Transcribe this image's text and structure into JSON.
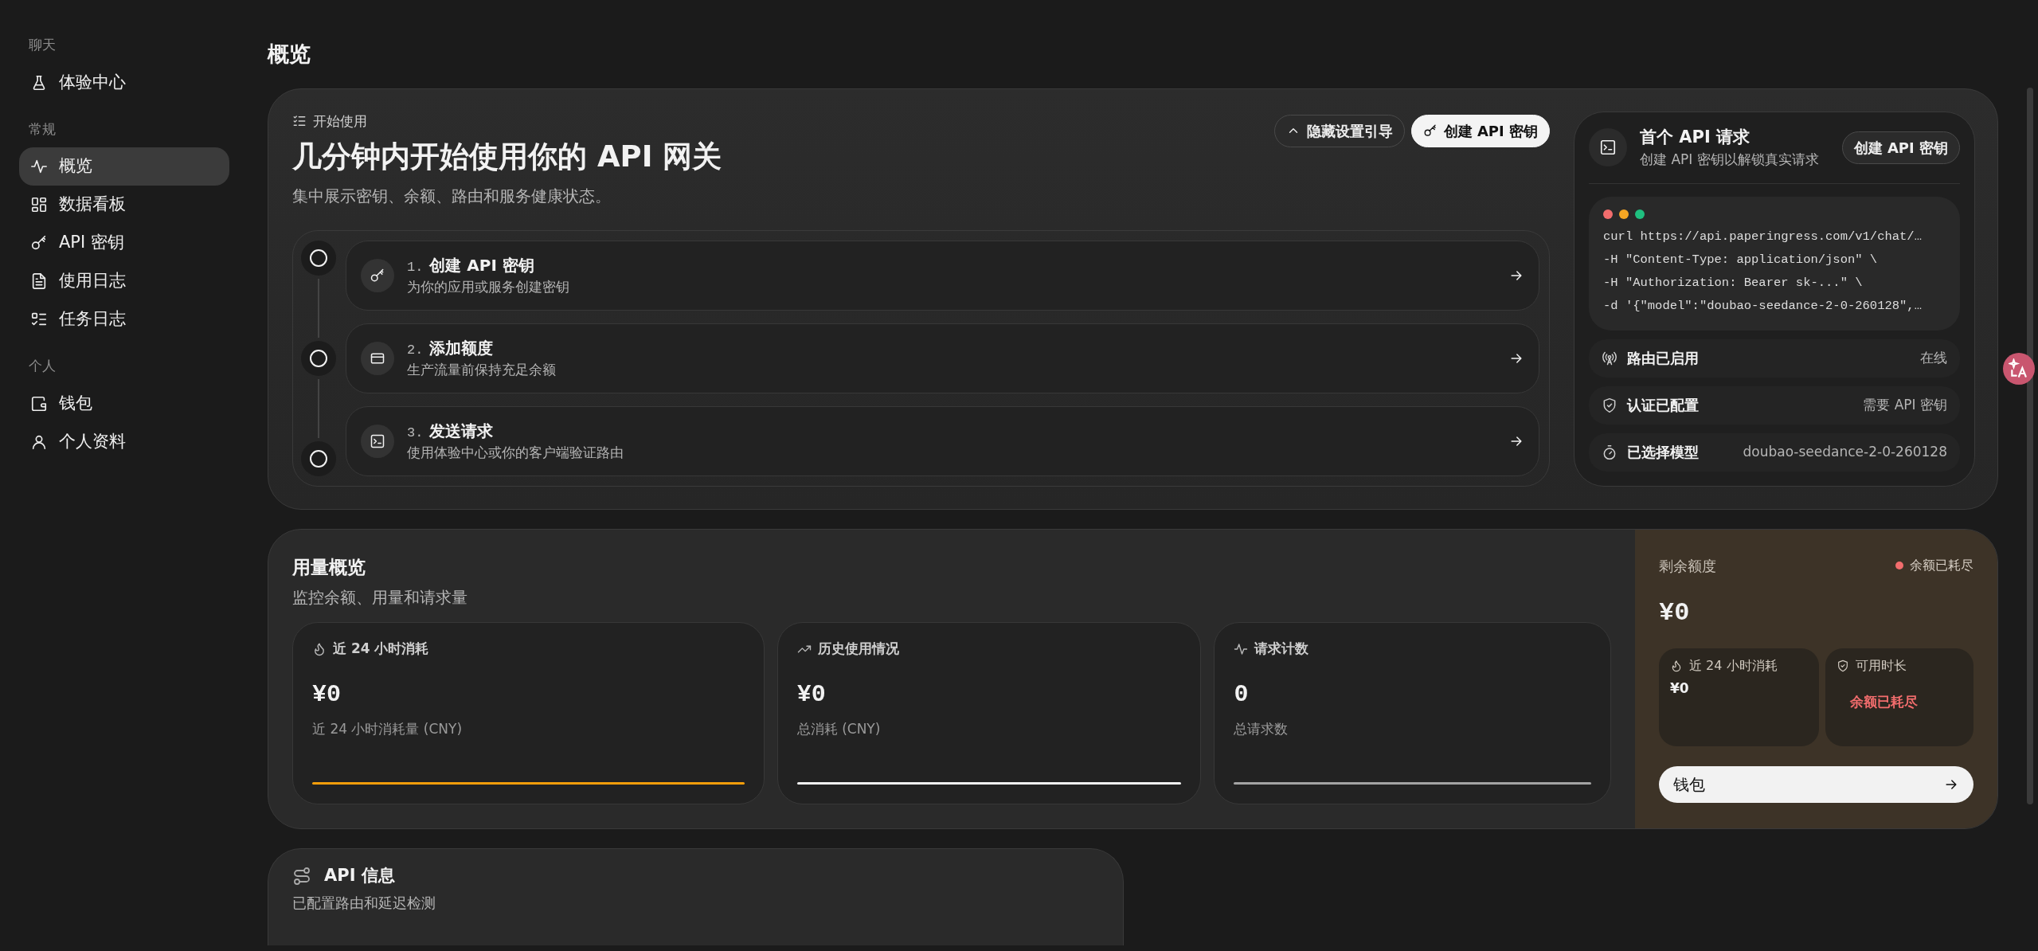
{
  "sidebar": {
    "sections": [
      {
        "label": "聊天",
        "items": [
          {
            "label": "体验中心",
            "selected": false
          }
        ]
      },
      {
        "label": "常规",
        "items": [
          {
            "label": "概览",
            "selected": true
          },
          {
            "label": "数据看板",
            "selected": false
          },
          {
            "label": "API 密钥",
            "selected": false
          },
          {
            "label": "使用日志",
            "selected": false
          },
          {
            "label": "任务日志",
            "selected": false
          }
        ]
      },
      {
        "label": "个人",
        "items": [
          {
            "label": "钱包",
            "selected": false
          },
          {
            "label": "个人资料",
            "selected": false
          }
        ]
      }
    ]
  },
  "page_title": "概览",
  "getting_started": {
    "label": "开始使用",
    "heading": "几分钟内开始使用你的 API 网关",
    "subtitle": "集中展示密钥、余额、路由和服务健康状态。",
    "buttons": [
      {
        "label": "隐藏设置引导",
        "kind": "outline"
      },
      {
        "label": "创建 API 密钥",
        "kind": "solid"
      }
    ],
    "steps": [
      {
        "number": "1.",
        "title": "创建 API 密钥",
        "description": "为你的应用或服务创建密钥",
        "completed": false
      },
      {
        "number": "2.",
        "title": "添加额度",
        "description": "生产流量前保持充足余额",
        "completed": false
      },
      {
        "number": "3.",
        "title": "发送请求",
        "description": "使用体验中心或你的客户端验证路由",
        "completed": false
      }
    ]
  },
  "first_request": {
    "title": "首个 API 请求",
    "subtitle": "创建 API 密钥以解锁真实请求",
    "button": "创建 API 密钥",
    "code_lines": [
      "curl https://api.paperingress.com/v1/chat/…",
      "-H \"Content-Type: application/json\" \\",
      "-H \"Authorization: Bearer sk-...\" \\",
      "-d '{\"model\":\"doubao-seedance-2-0-260128\",…"
    ],
    "status_rows": [
      {
        "label": "路由已启用",
        "value": "在线"
      },
      {
        "label": "认证已配置",
        "value": "需要 API 密钥"
      },
      {
        "label": "已选择模型",
        "value": "doubao-seedance-2-0-260128"
      }
    ]
  },
  "usage": {
    "title": "用量概览",
    "subtitle": "监控余额、用量和请求量",
    "stats": [
      {
        "label": "近 24 小时消耗",
        "value": "¥0",
        "caption": "近 24 小时消耗量 (CNY)",
        "color": "#f59e0b"
      },
      {
        "label": "历史使用情况",
        "value": "¥0",
        "caption": "总消耗 (CNY)",
        "color": "#f2f2f2"
      },
      {
        "label": "请求计数",
        "value": "0",
        "caption": "总请求数",
        "color": "#a3a3a3"
      }
    ]
  },
  "balance": {
    "label": "剩余额度",
    "status": {
      "text": "余额已耗尽",
      "color": "#f26d6d"
    },
    "amount": "¥0",
    "tiles": [
      {
        "label": "近 24 小时消耗",
        "value": "¥0",
        "kind": "normal"
      },
      {
        "label": "可用时长",
        "value": "余额已耗尽",
        "kind": "alert"
      }
    ],
    "button": "钱包"
  },
  "api_info": {
    "title": "API 信息",
    "subtitle": "已配置路由和延迟检测"
  }
}
